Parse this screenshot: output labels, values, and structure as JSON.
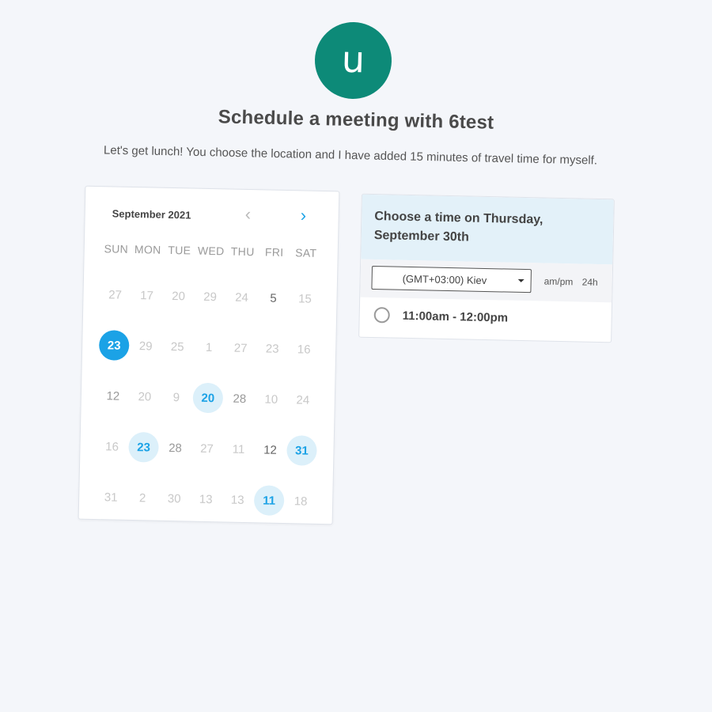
{
  "host": {
    "avatar_initial": "u",
    "avatar_color": "#0d8a78"
  },
  "header": {
    "title": "Schedule a meeting with 6test",
    "description": "Let's get lunch! You choose the location and I have added 15 minutes of travel time for myself."
  },
  "calendar": {
    "month_label": "September 2021",
    "prev_icon": "chevron-left-icon",
    "next_icon": "chevron-right-icon",
    "weekdays": [
      "SUN",
      "MON",
      "TUE",
      "WED",
      "THU",
      "FRI",
      "SAT"
    ],
    "selected_date": "23",
    "available_dates": [
      "20",
      "23",
      "31",
      "11"
    ],
    "weeks": [
      [
        {
          "d": "27",
          "s": "faded"
        },
        {
          "d": "17",
          "s": "faded"
        },
        {
          "d": "20",
          "s": "faded"
        },
        {
          "d": "29",
          "s": "faded"
        },
        {
          "d": "24",
          "s": "faded"
        },
        {
          "d": "5",
          "s": "dark"
        },
        {
          "d": "15",
          "s": "faded"
        }
      ],
      [
        {
          "d": "23",
          "s": "selected"
        },
        {
          "d": "29",
          "s": "faded"
        },
        {
          "d": "25",
          "s": "faded"
        },
        {
          "d": "1",
          "s": "faded"
        },
        {
          "d": "27",
          "s": "faded"
        },
        {
          "d": "23",
          "s": "faded"
        },
        {
          "d": "16",
          "s": "faded"
        }
      ],
      [
        {
          "d": "12",
          "s": "mid"
        },
        {
          "d": "20",
          "s": "faded"
        },
        {
          "d": "9",
          "s": "faded"
        },
        {
          "d": "20",
          "s": "available"
        },
        {
          "d": "28",
          "s": "mid"
        },
        {
          "d": "10",
          "s": "faded"
        },
        {
          "d": "24",
          "s": "faded"
        }
      ],
      [
        {
          "d": "16",
          "s": "faded"
        },
        {
          "d": "23",
          "s": "available"
        },
        {
          "d": "28",
          "s": "mid"
        },
        {
          "d": "27",
          "s": "faded"
        },
        {
          "d": "11",
          "s": "faded"
        },
        {
          "d": "12",
          "s": "dark"
        },
        {
          "d": "31",
          "s": "available"
        }
      ],
      [
        {
          "d": "31",
          "s": "faded"
        },
        {
          "d": "2",
          "s": "faded"
        },
        {
          "d": "30",
          "s": "faded"
        },
        {
          "d": "13",
          "s": "faded"
        },
        {
          "d": "13",
          "s": "faded"
        },
        {
          "d": "11",
          "s": "available"
        },
        {
          "d": "18",
          "s": "faded"
        }
      ]
    ]
  },
  "times": {
    "heading": "Choose a time on Thursday, September 30th",
    "timezone": "(GMT+03:00) Kiev",
    "format_12h": "am/pm",
    "format_24h": "24h",
    "slots": [
      {
        "label": "11:00am - 12:00pm"
      }
    ]
  },
  "colors": {
    "accent": "#1ba2e6",
    "available_bg": "#dcf0fa",
    "panel_header_bg": "#e3f1f9",
    "page_bg": "#f4f6fa"
  }
}
